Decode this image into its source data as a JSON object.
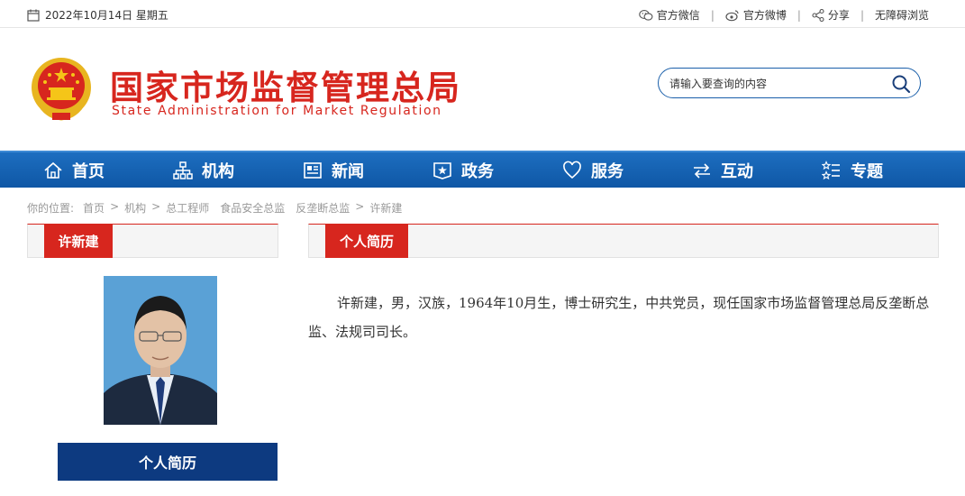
{
  "topbar": {
    "date": "2022年10月14日 星期五",
    "links": [
      {
        "label": "官方微信",
        "icon": "wechat-icon"
      },
      {
        "label": "官方微博",
        "icon": "weibo-icon"
      },
      {
        "label": "分享",
        "icon": "share-icon"
      },
      {
        "label": "无障碍浏览",
        "icon": ""
      }
    ],
    "separator": "|"
  },
  "header": {
    "org_name_cn": "国家市场监督管理总局",
    "org_name_en": "State Administration for Market Regulation",
    "search_placeholder": "请输入要查询的内容"
  },
  "nav": {
    "items": [
      {
        "label": "首页",
        "icon": "home-icon"
      },
      {
        "label": "机构",
        "icon": "org-chart-icon"
      },
      {
        "label": "新闻",
        "icon": "news-icon"
      },
      {
        "label": "政务",
        "icon": "government-icon"
      },
      {
        "label": "服务",
        "icon": "heart-icon"
      },
      {
        "label": "互动",
        "icon": "exchange-icon"
      },
      {
        "label": "专题",
        "icon": "topics-icon"
      }
    ]
  },
  "breadcrumb": {
    "prefix": "你的位置:",
    "items": [
      "首页",
      "机构",
      "总工程师",
      "食品安全总监",
      "反垄断总监",
      "许新建"
    ]
  },
  "left_panel": {
    "name": "许新建",
    "button_label": "个人简历"
  },
  "right_panel": {
    "title": "个人简历",
    "bio": "许新建，男，汉族，1964年10月生，博士研究生，中共党员，现任国家市场监督管理总局反垄断总监、法规司司长。"
  },
  "colors": {
    "brand_red": "#d7261e",
    "nav_blue": "#1564b4",
    "dark_blue": "#0d3a80"
  }
}
